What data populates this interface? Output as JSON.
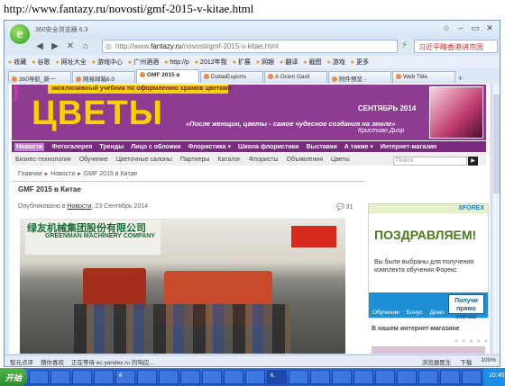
{
  "caption": "http://www.fantazy.ru/novosti/gmf-2015-v-kitae.html",
  "browser": {
    "logo": "e",
    "title": "360安全浏览器 6.3",
    "url_prefix": "http://www.",
    "url_domain": "fantazy.ru",
    "url_path": "/novosti/gmf-2015-v-kitae.html",
    "search_text": "习近平略香港讲京国",
    "window_buttons": [
      "☆",
      "–",
      "▭",
      "✕"
    ]
  },
  "favorites": [
    {
      "label": "收藏",
      "icon": "star-icon"
    },
    {
      "label": "谷歌",
      "icon": "google-icon"
    },
    {
      "label": "网址大全",
      "icon": "sites-icon"
    },
    {
      "label": "游戏中心",
      "icon": "game-icon"
    },
    {
      "label": "广州酒酒",
      "icon": "page-icon"
    },
    {
      "label": "http://p",
      "icon": "page-icon"
    },
    {
      "label": "2012年我",
      "icon": "page-icon"
    },
    {
      "label": "扩展",
      "icon": "extension-icon"
    },
    {
      "label": "网银",
      "icon": "bank-icon"
    },
    {
      "label": "翻译",
      "icon": "translate-icon"
    },
    {
      "label": "截图",
      "icon": "screenshot-icon"
    },
    {
      "label": "游戏",
      "icon": "game-icon"
    },
    {
      "label": "更多",
      "icon": "more-icon"
    }
  ],
  "tabs": [
    {
      "label": "360导航_新一"
    },
    {
      "label": "网易邮箱6.0"
    },
    {
      "label": "GMF 2015 в",
      "active": true
    },
    {
      "label": "DubaiExports"
    },
    {
      "label": "A Grant Gard"
    },
    {
      "label": "附件预览 - "
    },
    {
      "label": "Web Title"
    }
  ],
  "site": {
    "banner_tagline": "эксклюзивный учебник по оформлению храмов цветами",
    "logo": "ЦВЕТЫ",
    "logo_side": "flowers",
    "issue": "СЕНТЯБРЬ 2014",
    "quote": "«После женщин, цветы - самое чудесное создания на земле»",
    "quote_author": "Кристиан Диор",
    "main_menu": [
      {
        "label": "Новости",
        "active": true
      },
      {
        "label": "Фотогалерея"
      },
      {
        "label": "Тренды"
      },
      {
        "label": "Лицо с обложки"
      },
      {
        "label": "Флористика ▾"
      },
      {
        "label": "Школа флористики"
      },
      {
        "label": "Выставки"
      },
      {
        "label": "А также ▾"
      },
      {
        "label": "Интернет-магазин"
      }
    ],
    "sub_menu": [
      "Бизнес-технологии",
      "Обучение",
      "Цветочные салоны",
      "Партнеры",
      "Каталог",
      "Флористы",
      "Объявления",
      "Цветы"
    ],
    "search_placeholder": "Поиск",
    "breadcrumb": [
      "Главная",
      "Новости",
      "GMF 2015 в Китае"
    ],
    "article_title": "GMF 2015 в Китае",
    "meta_prefix": "Опубликовано в ",
    "meta_section": "Новости",
    "meta_date": ", 23 Сентябрь 2014",
    "comments": "31",
    "photo_sign_cn": "绿友机械集团股份有限公司",
    "photo_sign_en": "GREENMAN MACHINERY COMPANY",
    "ad": {
      "brand": "XFOREX",
      "headline": "ПОЗДРАВЛЯЕМ!",
      "text": "Вы были выбраны для получения комплекта обучения Форекс",
      "items": [
        "Обучение",
        "Бонус",
        "Демо"
      ],
      "button": "Получи прямо сейчас"
    },
    "shop_label": "В нашем интернет-магазине",
    "dots": "● ● ● ● ● ●"
  },
  "status": {
    "left1": "智元点评",
    "left2": "猜你喜欢",
    "loading": "正在等待 ec.yandex.ru 的响应...",
    "right": [
      "浏览器医生",
      "下载",
      "100%"
    ]
  },
  "taskbar": {
    "start": "开始",
    "items": [
      "",
      "",
      "",
      "",
      "6",
      "",
      "",
      "",
      "",
      "",
      "",
      "6.",
      "",
      "",
      "",
      "",
      "",
      "",
      "",
      "",
      ""
    ],
    "tray_time": "10:45"
  }
}
